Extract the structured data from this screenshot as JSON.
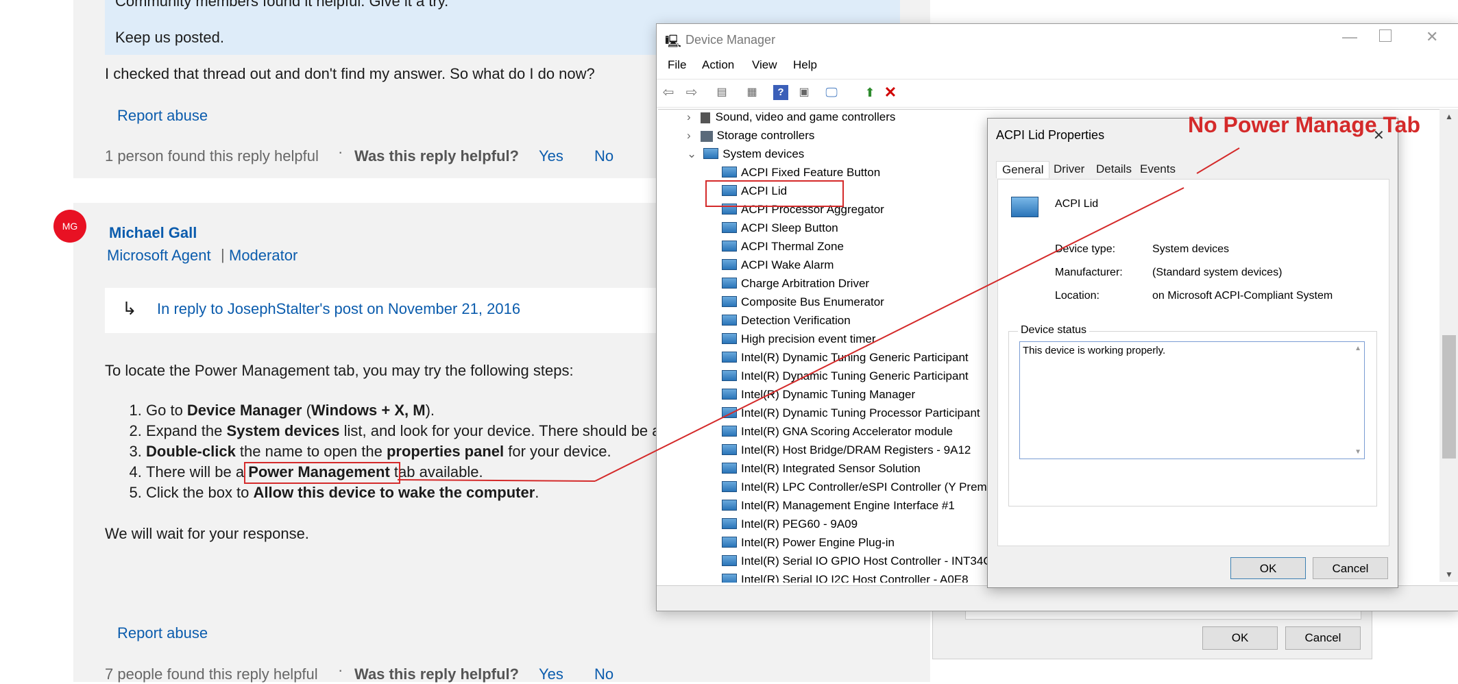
{
  "thread": {
    "quote_line_1": "Community members found it helpful. Give it a try.",
    "quote_line_2": "Keep us posted.",
    "reply_text": "I checked that thread out and don't find my answer. So what do I do now?",
    "report_abuse": "Report abuse",
    "helpful_count_1": "1 person found this reply helpful",
    "was_helpful": "Was this reply helpful?",
    "yes": "Yes",
    "no": "No",
    "dot": "·"
  },
  "post": {
    "avatar_initials": "MG",
    "author": "Michael Gall",
    "role_1": "Microsoft Agent",
    "role_sep": "|",
    "role_2": "Moderator",
    "reply_arrow": "↳",
    "in_reply_to": "In reply to JosephStalter's post on November 21, 2016",
    "intro": "To locate the Power Management tab, you may try the following steps:",
    "steps": {
      "s1_a": "Go to ",
      "s1_b": "Device Manager",
      "s1_c": " (",
      "s1_d": "Windows + X, M",
      "s1_e": ").",
      "s2_a": "Expand the ",
      "s2_b": "System devices",
      "s2_c": " list, and look for your device. There should be a",
      "s3_a": "Double-click",
      "s3_b": " the name to open the ",
      "s3_c": "properties panel",
      "s3_d": " for your device.",
      "s4_a": "There will be a ",
      "s4_b": "Power Management",
      "s4_c": " tab available.",
      "s5_a": "Click the box to ",
      "s5_b": "Allow this device to wake the computer",
      "s5_c": "."
    },
    "closing": "We will wait for your response.",
    "report_abuse": "Report abuse",
    "helpful_count": "7 people found this reply helpful",
    "was_helpful": "Was this reply helpful?",
    "yes": "Yes",
    "no": "No"
  },
  "device_manager": {
    "title": "Device Manager",
    "menu": [
      "File",
      "Action",
      "View",
      "Help"
    ],
    "tree_top": [
      {
        "label": "Sound, video and game controllers",
        "expander": "›"
      },
      {
        "label": "Storage controllers",
        "expander": "›"
      },
      {
        "label": "System devices",
        "expander": "⌄"
      }
    ],
    "system_devices": [
      "ACPI Fixed Feature Button",
      "ACPI Lid",
      "ACPI Processor Aggregator",
      "ACPI Sleep Button",
      "ACPI Thermal Zone",
      "ACPI Wake Alarm",
      "Charge Arbitration Driver",
      "Composite Bus Enumerator",
      "Detection Verification",
      "High precision event timer",
      "Intel(R) Dynamic Tuning Generic Participant",
      "Intel(R) Dynamic Tuning Generic Participant",
      "Intel(R) Dynamic Tuning Manager",
      "Intel(R) Dynamic Tuning Processor Participant",
      "Intel(R) GNA Scoring Accelerator module",
      "Intel(R) Host Bridge/DRAM Registers - 9A12",
      "Intel(R) Integrated Sensor Solution",
      "Intel(R) LPC Controller/eSPI Controller (Y Premi",
      "Intel(R) Management Engine Interface #1",
      "Intel(R) PEG60 - 9A09",
      "Intel(R) Power Engine Plug-in",
      "Intel(R) Serial IO GPIO Host Controller - INT34C",
      "Intel(R) Serial IO I2C Host Controller - A0E8"
    ]
  },
  "properties": {
    "title": "ACPI Lid Properties",
    "close": "✕",
    "tabs": [
      "General",
      "Driver",
      "Details",
      "Events"
    ],
    "device_name": "ACPI Lid",
    "fields": [
      {
        "label": "Device type:",
        "value": "System devices"
      },
      {
        "label": "Manufacturer:",
        "value": "(Standard system devices)"
      },
      {
        "label": "Location:",
        "value": "on Microsoft ACPI-Compliant System"
      }
    ],
    "status_group": "Device status",
    "status_text": "This device is working properly.",
    "ok": "OK",
    "cancel": "Cancel"
  },
  "behind_dialog": {
    "ok": "OK",
    "cancel": "Cancel"
  },
  "annotation": {
    "text": "No Power Manage Tab",
    "color": "#d42a2a"
  },
  "colors": {
    "link": "#0b5cad",
    "avatar": "#e81123",
    "highlight": "#d42a2a"
  }
}
